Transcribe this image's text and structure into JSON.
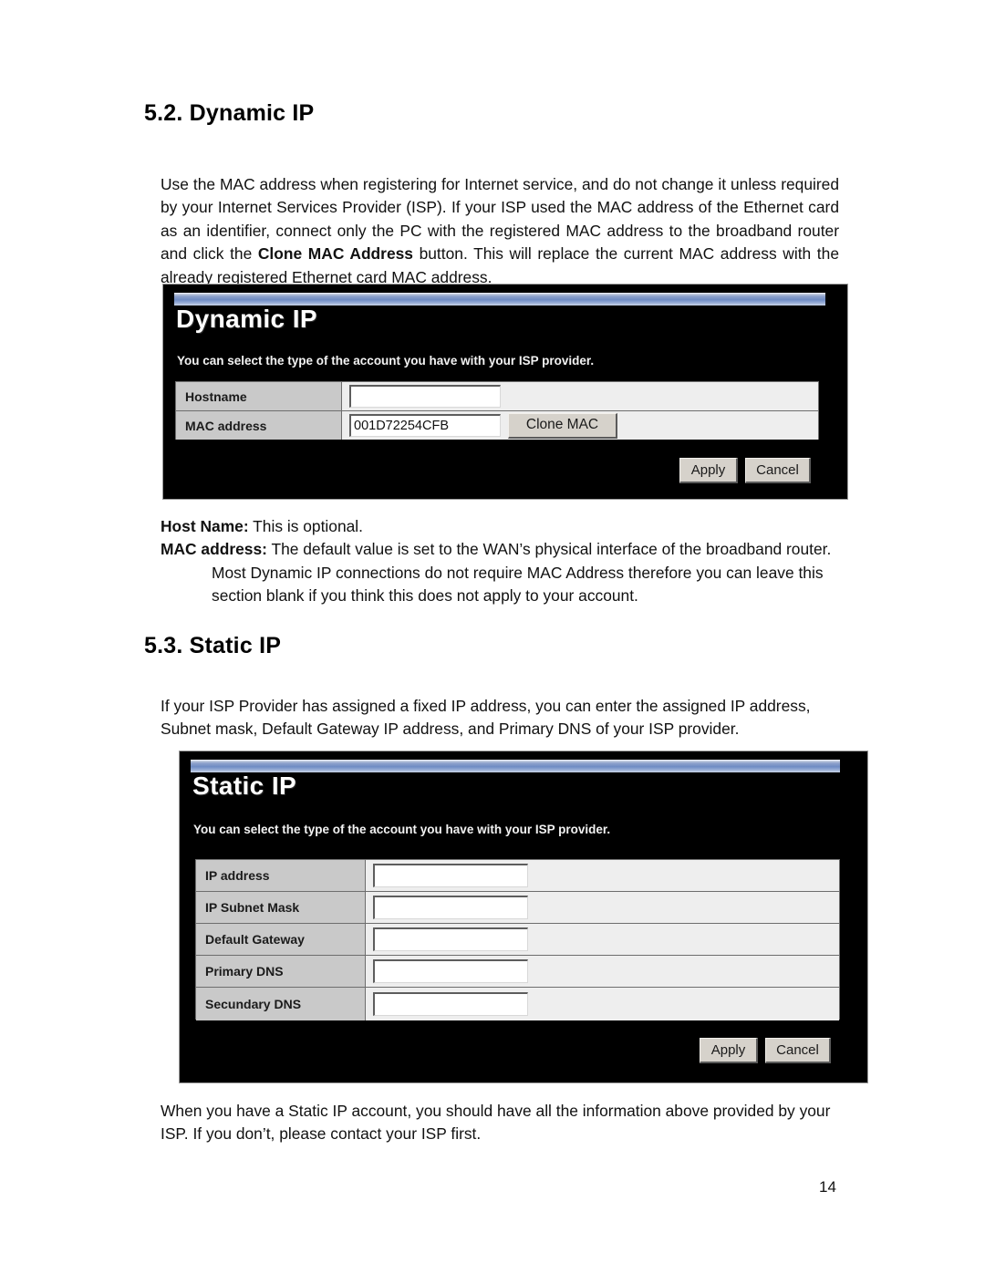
{
  "document": {
    "page_number": "14",
    "sections": [
      {
        "heading": "5.2. Dynamic IP",
        "intro": "Use the MAC address when registering for Internet service, and do not change it unless required by your Internet Services Provider (ISP). If your ISP used the MAC address of the Ethernet card as an identifier, connect only the PC with the registered MAC address to the broadband router and click the Clone MAC Address button. This will replace the current MAC address with the already registered Ethernet card MAC address.",
        "intro_bold_phrase": "Clone MAC Address"
      },
      {
        "heading": "5.3. Static IP",
        "intro": "If your ISP Provider has assigned a fixed IP address, you can enter the assigned IP address, Subnet mask, Default Gateway IP address, and Primary DNS of your ISP provider."
      }
    ],
    "dynamic_ip_notes": {
      "host_name_label": "Host Name:",
      "host_name_text": " This is optional.",
      "mac_label": "MAC address:",
      "mac_text": " The default value is set to the WAN’s physical interface of the broadband router. Most Dynamic IP connections do not require MAC Address therefore you can leave this section blank if you think this does not apply to your account."
    },
    "static_ip_footer": "When you have a Static IP account, you should have all the information above provided by your ISP. If you don’t, please contact your ISP first."
  },
  "dynamic_ip_panel": {
    "title": "Dynamic IP",
    "description": "You can select the type of the account you have with your ISP provider.",
    "rows": [
      {
        "label": "Hostname",
        "value": "",
        "has_button": false
      },
      {
        "label": "MAC address",
        "value": "001D72254CFB",
        "has_button": true,
        "button_label": "Clone MAC"
      }
    ],
    "buttons": {
      "apply": "Apply",
      "cancel": "Cancel"
    }
  },
  "static_ip_panel": {
    "title": "Static IP",
    "description": "You can select the type of the account you have with your ISP provider.",
    "rows": [
      {
        "label": "IP address",
        "value": ""
      },
      {
        "label": "IP Subnet Mask",
        "value": ""
      },
      {
        "label": "Default Gateway",
        "value": ""
      },
      {
        "label": "Primary DNS",
        "value": ""
      },
      {
        "label": "Secundary DNS",
        "value": ""
      }
    ],
    "buttons": {
      "apply": "Apply",
      "cancel": "Cancel"
    }
  },
  "colors": {
    "panel_background": "#000000",
    "titlebar_blue": "#6f8cc4",
    "label_cell_gray": "#c9c9c9",
    "value_cell_gray": "#eeeeee",
    "button_face": "#d6d2cb"
  }
}
